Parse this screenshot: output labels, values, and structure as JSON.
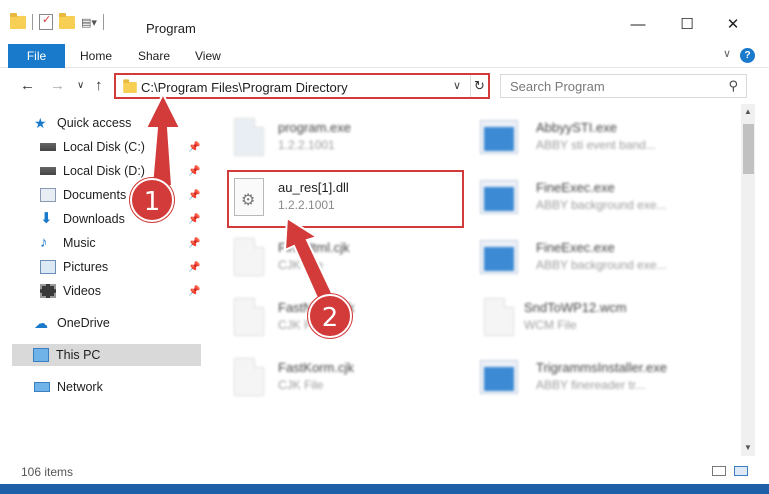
{
  "window": {
    "title": "Program",
    "minimize": "—",
    "maximize": "☐",
    "close": "✕"
  },
  "ribbon": {
    "tabs": [
      "File",
      "Home",
      "Share",
      "View"
    ],
    "help": "?",
    "expand": "∨"
  },
  "address": {
    "path": "C:\\Program Files\\Program Directory",
    "dropdown": "∨",
    "refresh": "↻",
    "back": "←",
    "forward": "→",
    "recent": "∨",
    "up": "↑"
  },
  "search": {
    "placeholder": "Search Program",
    "icon": "⚲"
  },
  "sidebar": {
    "items": [
      {
        "label": "Quick access",
        "icon": "star-icon"
      },
      {
        "label": "Local Disk (C:)",
        "icon": "drive-icon",
        "pinned": true
      },
      {
        "label": "Local Disk (D:)",
        "icon": "drive-icon",
        "pinned": true
      },
      {
        "label": "Documents",
        "icon": "documents-icon",
        "pinned": true
      },
      {
        "label": "Downloads",
        "icon": "downloads-icon",
        "pinned": true
      },
      {
        "label": "Music",
        "icon": "music-icon",
        "pinned": true
      },
      {
        "label": "Pictures",
        "icon": "pictures-icon",
        "pinned": true
      },
      {
        "label": "Videos",
        "icon": "videos-icon",
        "pinned": true
      },
      {
        "label": "OneDrive",
        "icon": "cloud-icon"
      },
      {
        "label": "This PC",
        "icon": "pc-icon",
        "selected": true
      },
      {
        "label": "Network",
        "icon": "network-icon"
      }
    ]
  },
  "files": [
    {
      "name": "program.exe",
      "sub": "1.2.2.1001",
      "type": "exe"
    },
    {
      "name": "AbbyySTI.exe",
      "sub": "ABBY sti event band...",
      "type": "app"
    },
    {
      "name": "au_res[1].dll",
      "sub": "1.2.2.1001",
      "type": "dll",
      "highlighted": true
    },
    {
      "name": "FineExec.exe",
      "sub": "ABBY background exe...",
      "type": "app"
    },
    {
      "name": "FineHtml.cjk",
      "sub": "CJK File",
      "type": "doc"
    },
    {
      "name": "FineExec.exe",
      "sub": "ABBY background exe...",
      "type": "app"
    },
    {
      "name": "FastNorm.cjk",
      "sub": "CJK File",
      "type": "doc"
    },
    {
      "name": "SndToWP12.wcm",
      "sub": "WCM File",
      "type": "doc"
    },
    {
      "name": "FastKorm.cjk",
      "sub": "CJK File",
      "type": "doc"
    },
    {
      "name": "TrigrammsInstaller.exe",
      "sub": "ABBY finereader tr...",
      "type": "app"
    }
  ],
  "callouts": [
    "1",
    "2"
  ],
  "status": {
    "count": "106 items"
  },
  "colors": {
    "accent": "#1979ca",
    "highlight": "#d33a3a"
  }
}
